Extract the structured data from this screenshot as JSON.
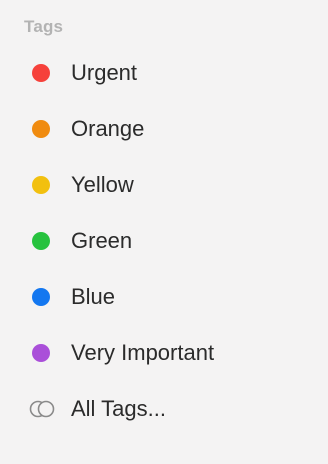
{
  "sidebar": {
    "section_title": "Tags",
    "tags": [
      {
        "label": "Urgent",
        "color": "#f6413b"
      },
      {
        "label": "Orange",
        "color": "#f08b0f"
      },
      {
        "label": "Yellow",
        "color": "#f2c00f"
      },
      {
        "label": "Green",
        "color": "#27c23e"
      },
      {
        "label": "Blue",
        "color": "#1377f0"
      },
      {
        "label": "Very Important",
        "color": "#aa4fd9"
      }
    ],
    "all_tags": {
      "label": "All Tags...",
      "icon": "tags-icon"
    }
  }
}
